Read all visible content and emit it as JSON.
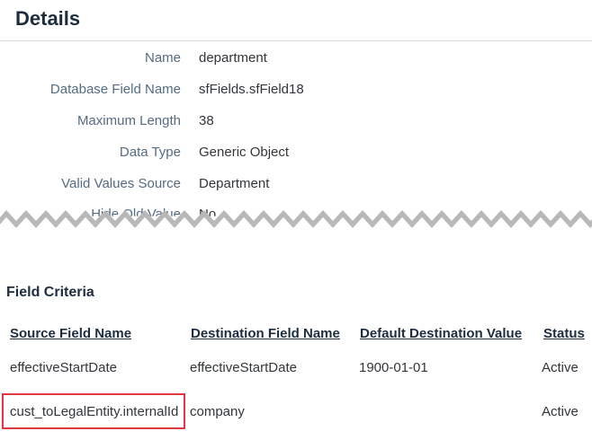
{
  "header": {
    "title": "Details"
  },
  "details": {
    "rows": [
      {
        "label": "Name",
        "value": "department"
      },
      {
        "label": "Database Field Name",
        "value": "sfFields.sfField18"
      },
      {
        "label": "Maximum Length",
        "value": "38"
      },
      {
        "label": "Data Type",
        "value": "Generic Object"
      },
      {
        "label": "Valid Values Source",
        "value": "Department"
      },
      {
        "label": "Hide Old Value",
        "value": "No"
      }
    ]
  },
  "field_criteria": {
    "title": "Field Criteria",
    "columns": [
      "Source Field Name",
      "Destination Field Name",
      "Default Destination Value",
      "Status"
    ],
    "rows": [
      {
        "source": "effectiveStartDate",
        "destination": "effectiveStartDate",
        "default": "1900-01-01",
        "status": "Active"
      },
      {
        "source": "cust_toLegalEntity.internalId",
        "destination": "company",
        "default": "",
        "status": "Active"
      }
    ]
  },
  "colors": {
    "highlight": "#e0383e",
    "label": "#556b82",
    "heading": "#1d2d3e"
  }
}
